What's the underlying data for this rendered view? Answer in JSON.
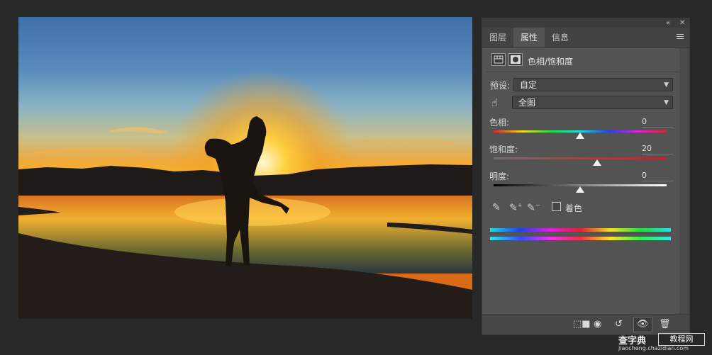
{
  "panel": {
    "tabs": [
      "图层",
      "属性",
      "信息"
    ],
    "active_tab": "属性",
    "title": "色相/饱和度",
    "preset_label": "预设:",
    "preset_value": "自定",
    "channel_value": "全图",
    "sliders": [
      {
        "label": "色相:",
        "value": "0",
        "level": 0.5
      },
      {
        "label": "饱和度:",
        "value": "20",
        "level": 0.6
      },
      {
        "label": "明度:",
        "value": "0",
        "level": 0.5
      }
    ],
    "colorize_label": "着色"
  },
  "watermark": {
    "main": "查字典",
    "box": "教程网",
    "url": "jiaocheng.chazidian.com"
  },
  "colors": {
    "panel_bg": "#535353",
    "app_bg": "#282828"
  },
  "icons": [
    "collapse-icon",
    "close-icon",
    "panel-menu-icon",
    "adjustment-layer-icon",
    "mask-icon",
    "target-hand-icon",
    "eyedropper-icon",
    "eyedropper-plus-icon",
    "eyedropper-minus-icon",
    "clip-to-layer-icon",
    "view-previous-icon",
    "reset-icon",
    "visibility-icon",
    "trash-icon"
  ]
}
